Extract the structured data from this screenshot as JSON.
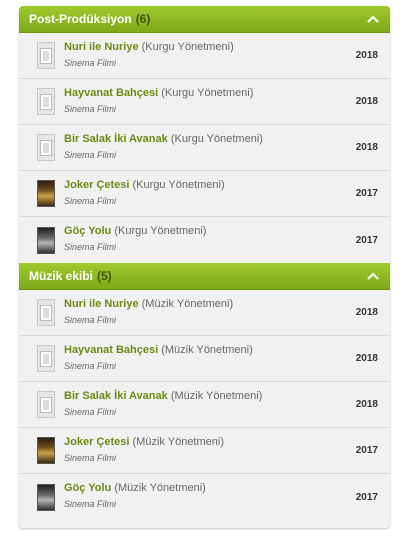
{
  "sections": [
    {
      "title": "Post-Prodüksiyon",
      "count": "(6)",
      "items": [
        {
          "title": "Nuri ile Nuriye",
          "role": "(Kurgu Yönetmeni)",
          "type": "Sinema Filmi",
          "year": "2018",
          "thumb": "placeholder"
        },
        {
          "title": "Hayvanat Bahçesi",
          "role": "(Kurgu Yönetmeni)",
          "type": "Sinema Filmi",
          "year": "2018",
          "thumb": "placeholder"
        },
        {
          "title": "Bir Salak İki Avanak",
          "role": "(Kurgu Yönetmeni)",
          "type": "Sinema Filmi",
          "year": "2018",
          "thumb": "placeholder"
        },
        {
          "title": "Joker Çetesi",
          "role": "(Kurgu Yönetmeni)",
          "type": "Sinema Filmi",
          "year": "2017",
          "thumb": "poster-joker"
        },
        {
          "title": "Göç Yolu",
          "role": "(Kurgu Yönetmeni)",
          "type": "Sinema Filmi",
          "year": "2017",
          "thumb": "poster-goc"
        }
      ]
    },
    {
      "title": "Müzik ekibi",
      "count": "(5)",
      "items": [
        {
          "title": "Nuri ile Nuriye",
          "role": "(Müzik Yönetmeni)",
          "type": "Sinema Filmi",
          "year": "2018",
          "thumb": "placeholder"
        },
        {
          "title": "Hayvanat Bahçesi",
          "role": "(Müzik Yönetmeni)",
          "type": "Sinema Filmi",
          "year": "2018",
          "thumb": "placeholder"
        },
        {
          "title": "Bir Salak İki Avanak",
          "role": "(Müzik Yönetmeni)",
          "type": "Sinema Filmi",
          "year": "2018",
          "thumb": "placeholder"
        },
        {
          "title": "Joker Çetesi",
          "role": "(Müzik Yönetmeni)",
          "type": "Sinema Filmi",
          "year": "2017",
          "thumb": "poster-joker"
        },
        {
          "title": "Göç Yolu",
          "role": "(Müzik Yönetmeni)",
          "type": "Sinema Filmi",
          "year": "2017",
          "thumb": "poster-goc"
        }
      ]
    }
  ],
  "icons": {
    "collapse": "chevron-up-icon",
    "placeholder": "film-placeholder-icon",
    "poster": "movie-poster-image"
  },
  "colors": {
    "header_green": "#8fb823",
    "title_green": "#6a8a13",
    "count_dark": "#41580a",
    "panel_bg": "#f1f1f1"
  }
}
